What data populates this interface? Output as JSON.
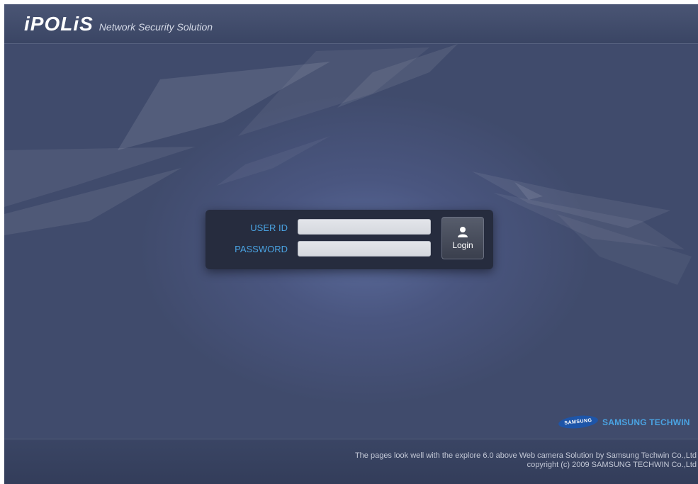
{
  "header": {
    "logo_main": "iPOLiS",
    "logo_sub": "Network Security Solution"
  },
  "login": {
    "user_id_label": "USER ID",
    "password_label": "PASSWORD",
    "user_id_value": "",
    "password_value": "",
    "login_button_label": "Login"
  },
  "brand": {
    "badge": "SAMSUNG",
    "name": "SAMSUNG TECHWIN"
  },
  "footer": {
    "line1": "The pages look well with the explore 6.0 above Web camera Solution by Samsung Techwin Co.,Ltd",
    "line2": "copyright (c) 2009 SAMSUNG TECHWIN Co.,Ltd"
  },
  "colors": {
    "background": "#3d4868",
    "label_blue": "#4aa3e2",
    "panel": "#262c3e"
  }
}
